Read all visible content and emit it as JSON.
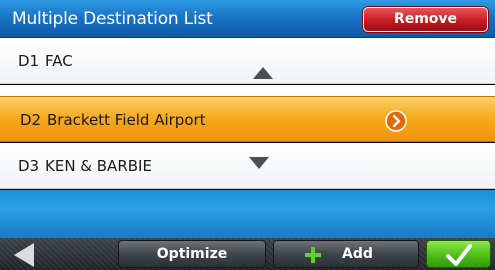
{
  "header": {
    "title": "Multiple Destination List",
    "remove_label": "Remove"
  },
  "destinations": [
    {
      "code": "D1",
      "name": "FAC",
      "selected": false
    },
    {
      "code": "D2",
      "name": "Brackett Field Airport",
      "selected": true
    },
    {
      "code": "D3",
      "name": "KEN & BARBIE",
      "selected": false
    }
  ],
  "toolbar": {
    "back_icon": "back-arrow-icon",
    "optimize_label": "Optimize",
    "add_icon": "plus-icon",
    "add_label": "Add",
    "confirm_icon": "checkmark-icon"
  },
  "icons": {
    "scroll_up": "scroll-up-icon",
    "scroll_down": "scroll-down-icon",
    "details": "details-arrow-icon"
  },
  "colors": {
    "header_blue": "#1a74c6",
    "selected_row": "#f6a918",
    "remove_red": "#c51d24",
    "confirm_green": "#54c21a"
  }
}
